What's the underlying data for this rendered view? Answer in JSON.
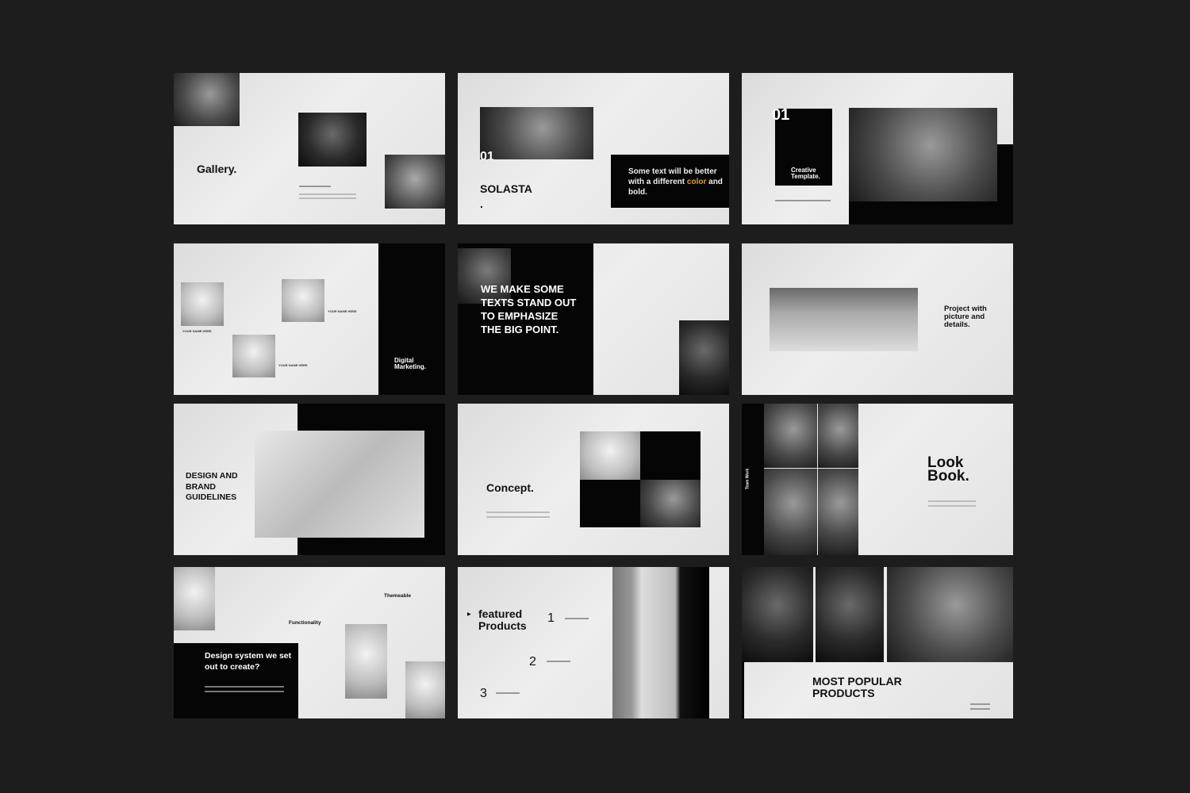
{
  "slides": {
    "gallery": {
      "title": "Gallery."
    },
    "solasta": {
      "number": "01",
      "title": "SOLASTA",
      "dot": ".",
      "callout_pre": "Some text will be better with a different ",
      "callout_accent": "color",
      "callout_post": " and bold.",
      "accent_color": "#e0a020"
    },
    "creative": {
      "number": "01",
      "title": "Creative Template."
    },
    "team": {
      "names": [
        "YOUR NAME HERE",
        "YOUR NAME HERE",
        "YOUR NAME HERE"
      ],
      "title": "Digital Marketing."
    },
    "statement": {
      "text": "WE MAKE SOME TEXTS STAND OUT TO EMPHASIZE THE BIG POINT."
    },
    "project": {
      "title": "Project with picture and details."
    },
    "guidelines": {
      "title": "DESIGN AND BRAND GUIDELINES"
    },
    "concept": {
      "title": "Concept."
    },
    "lookbook": {
      "side": "Team Work",
      "title": "Look Book."
    },
    "design_system": {
      "title": "Design system we set out to create?",
      "feature1": "Themeable",
      "feature2": "Functionality"
    },
    "featured": {
      "title": "featured Products",
      "numbers": [
        "1",
        "2",
        "3"
      ]
    },
    "popular": {
      "title": "MOST POPULAR PRODUCTS"
    }
  }
}
